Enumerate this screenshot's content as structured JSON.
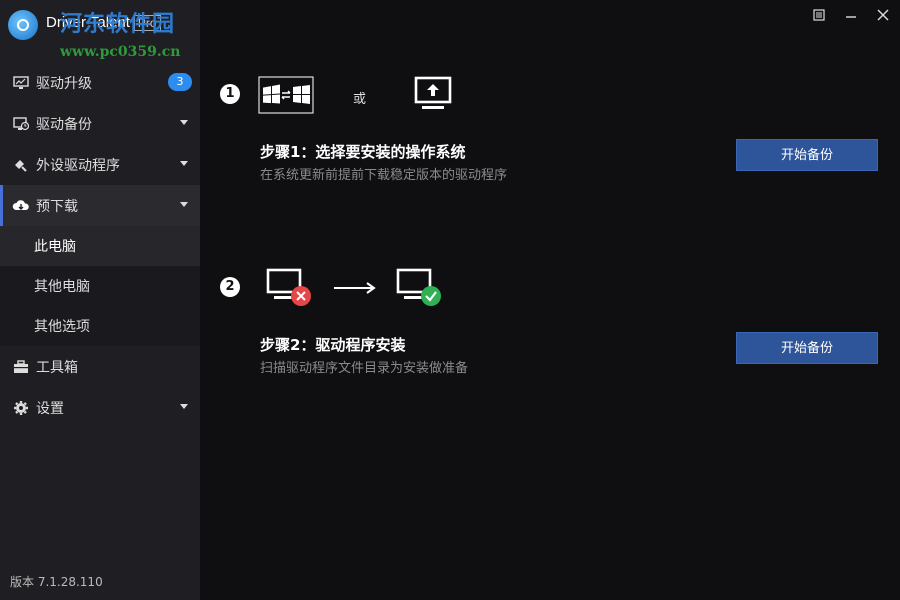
{
  "app": {
    "name": "Driver Talent",
    "edition": "Pro",
    "watermark": "河东软件园",
    "watermark_url": "www.pc0359.cn"
  },
  "window_controls": [
    "menu-icon",
    "minimize-icon",
    "close-icon"
  ],
  "sidebar": {
    "items": [
      {
        "label": "驱动升级",
        "icon": "monitor-icon",
        "badge": "3"
      },
      {
        "label": "驱动备份",
        "icon": "backup-icon",
        "caret": true
      },
      {
        "label": "外设驱动程序",
        "icon": "peripheral-icon",
        "caret": true
      },
      {
        "label": "预下载",
        "icon": "cloud-download-icon",
        "caret": true,
        "active": true
      }
    ],
    "sub_items": [
      {
        "label": "此电脑",
        "selected": true
      },
      {
        "label": "其他电脑"
      },
      {
        "label": "其他选项"
      }
    ],
    "bottom_items": [
      {
        "label": "工具箱",
        "icon": "toolbox-icon"
      },
      {
        "label": "设置",
        "icon": "gear-icon",
        "caret": true
      }
    ],
    "version": "版本 7.1.28.110"
  },
  "steps": [
    {
      "number": "1",
      "or": "或",
      "title": "步骤1：选择要安装的操作系统",
      "description": "在系统更新前提前下载稳定版本的驱动程序",
      "button": "开始备份"
    },
    {
      "number": "2",
      "title": "步骤2：驱动程序安装",
      "description": "扫描驱动程序文件目录为安装做准备",
      "button": "开始备份"
    }
  ],
  "colors": {
    "accent": "#2d8cf0",
    "button": "#2e5599",
    "error": "#e64646",
    "success": "#2fb052"
  }
}
